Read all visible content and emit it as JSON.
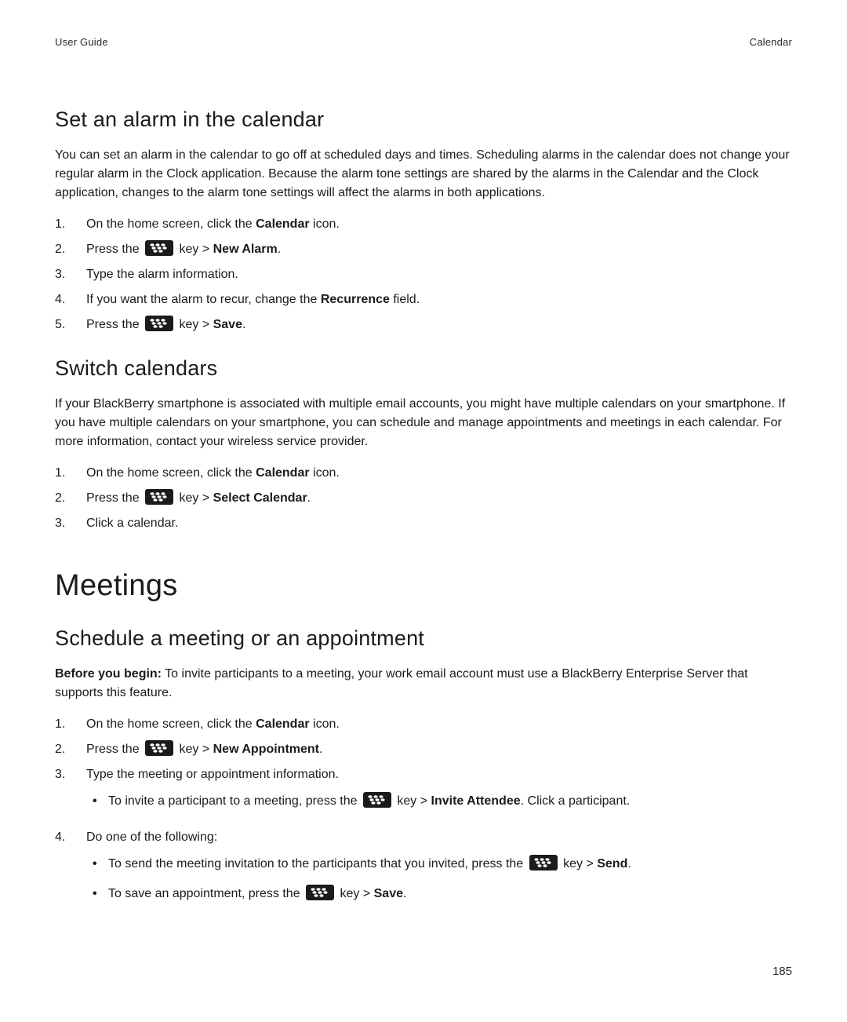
{
  "header": {
    "left": "User Guide",
    "right": "Calendar"
  },
  "sections": {
    "alarm": {
      "heading": "Set an alarm in the calendar",
      "intro": "You can set an alarm in the calendar to go off at scheduled days and times. Scheduling alarms in the calendar does not change your regular alarm in the Clock application. Because the alarm tone settings are shared by the alarms in the Calendar and the Clock application, changes to the alarm tone settings will affect the alarms in both applications.",
      "steps": {
        "s1_a": "On the home screen, click the ",
        "s1_b_bold": "Calendar",
        "s1_c": " icon.",
        "s2_a": "Press the ",
        "s2_mid": " key > ",
        "s2_b_bold": "New Alarm",
        "s2_c": ".",
        "s3": "Type the alarm information.",
        "s4_a": "If you want the alarm to recur, change the ",
        "s4_b_bold": "Recurrence",
        "s4_c": " field.",
        "s5_a": "Press the ",
        "s5_mid": " key > ",
        "s5_b_bold": "Save",
        "s5_c": "."
      }
    },
    "switch": {
      "heading": "Switch calendars",
      "intro": "If your BlackBerry smartphone is associated with multiple email accounts, you might have multiple calendars on your smartphone. If you have multiple calendars on your smartphone, you can schedule and manage appointments and meetings in each calendar. For more information, contact your wireless service provider.",
      "steps": {
        "s1_a": "On the home screen, click the ",
        "s1_b_bold": "Calendar",
        "s1_c": " icon.",
        "s2_a": "Press the ",
        "s2_mid": " key > ",
        "s2_b_bold": "Select Calendar",
        "s2_c": ".",
        "s3": "Click a calendar."
      }
    },
    "meetings": {
      "chapter": "Meetings",
      "schedule": {
        "heading": "Schedule a meeting or an appointment",
        "before_label": "Before you begin:",
        "before_text": " To invite participants to a meeting, your work email account must use a BlackBerry Enterprise Server that supports this feature.",
        "steps": {
          "s1_a": "On the home screen, click the ",
          "s1_b_bold": "Calendar",
          "s1_c": " icon.",
          "s2_a": "Press the ",
          "s2_mid": " key > ",
          "s2_b_bold": "New Appointment",
          "s2_c": ".",
          "s3": "Type the meeting or appointment information.",
          "s3_sub_a": "To invite a participant to a meeting, press the ",
          "s3_sub_mid": " key > ",
          "s3_sub_b_bold": "Invite Attendee",
          "s3_sub_c": ". Click a participant.",
          "s4": "Do one of the following:",
          "s4_sub1_a": "To send the meeting invitation to the participants that you invited, press the ",
          "s4_sub1_mid": " key > ",
          "s4_sub1_b_bold": "Send",
          "s4_sub1_c": ".",
          "s4_sub2_a": "To save an appointment, press the ",
          "s4_sub2_mid": " key > ",
          "s4_sub2_b_bold": "Save",
          "s4_sub2_c": "."
        }
      }
    }
  },
  "page_number": "185",
  "nums": {
    "n1": "1.",
    "n2": "2.",
    "n3": "3.",
    "n4": "4.",
    "n5": "5."
  }
}
